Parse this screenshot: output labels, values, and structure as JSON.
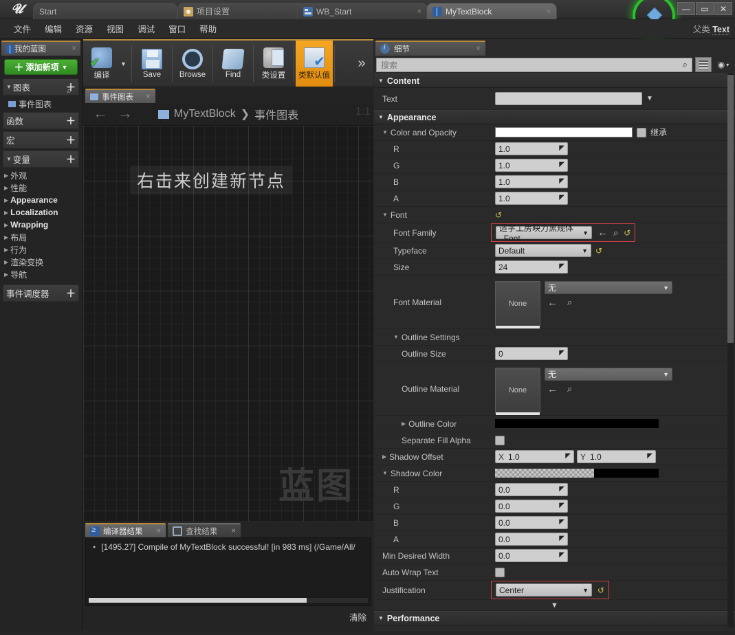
{
  "window": {
    "tabs": [
      {
        "label": "Start",
        "icon": "none",
        "active": false,
        "closable": false
      },
      {
        "label": "项目设置",
        "icon": "gear-icon",
        "active": false,
        "closable": true
      },
      {
        "label": "WB_Start",
        "icon": "widget-icon",
        "active": false,
        "closable": true
      },
      {
        "label": "MyTextBlock",
        "icon": "book-icon",
        "active": true,
        "closable": true
      }
    ],
    "minimize": "—",
    "maximize": "▭",
    "close": "✕"
  },
  "menu": {
    "items": [
      "文件",
      "编辑",
      "资源",
      "视图",
      "调试",
      "窗口",
      "帮助"
    ],
    "parent_class_label": "父类",
    "parent_class_value": "Text"
  },
  "left_panel": {
    "tab_label": "我的蓝图",
    "tab_close": "×",
    "add_button": "添加新项",
    "add_plus": "＋",
    "add_caret": "▼",
    "sections": [
      {
        "label": "图表",
        "plus": "＋",
        "expanded": true
      },
      {
        "label": "函数",
        "plus": "＋",
        "expanded": false
      },
      {
        "label": "宏",
        "plus": "＋",
        "expanded": false
      },
      {
        "label": "变量",
        "plus": "＋",
        "expanded": true
      }
    ],
    "graph_item": "事件图表",
    "variables": [
      {
        "label": "外观",
        "bold": false
      },
      {
        "label": "性能",
        "bold": false
      },
      {
        "label": "Appearance",
        "bold": true
      },
      {
        "label": "Localization",
        "bold": true
      },
      {
        "label": "Wrapping",
        "bold": true
      },
      {
        "label": "布局",
        "bold": false
      },
      {
        "label": "行为",
        "bold": false
      },
      {
        "label": "渲染变换",
        "bold": false
      },
      {
        "label": "导航",
        "bold": false
      }
    ],
    "dispatcher": {
      "label": "事件调度器",
      "plus": "＋"
    }
  },
  "toolbar": {
    "items": [
      {
        "label": "编译",
        "icon": "compile-icon",
        "active": false,
        "has_dropdown": true
      },
      {
        "label": "Save",
        "icon": "save-icon",
        "active": false
      },
      {
        "label": "Browse",
        "icon": "browse-icon",
        "active": false
      },
      {
        "label": "Find",
        "icon": "find-icon",
        "active": false
      },
      {
        "label": "类设置",
        "icon": "class-settings-icon",
        "active": false
      },
      {
        "label": "类默认值",
        "icon": "class-defaults-icon",
        "active": true
      }
    ],
    "overflow": "»"
  },
  "graph": {
    "tab_label": "事件图表",
    "tab_close": "×",
    "back_arrow": "←",
    "forward_arrow": "→",
    "breadcrumb_root": "MyTextBlock",
    "breadcrumb_sep": "❯",
    "breadcrumb_leaf": "事件图表",
    "zoom_level": "1:1",
    "hint": "右击来创建新节点",
    "watermark": "蓝图"
  },
  "results": {
    "tabs": [
      {
        "label": "编译器结果",
        "icon": "compiler-icon",
        "active": true,
        "close": "×"
      },
      {
        "label": "查找结果",
        "icon": "find-results-icon",
        "active": false,
        "close": "×"
      }
    ],
    "log_line": "[1495.27] Compile of MyTextBlock successful! [in 983 ms] (/Game/All/",
    "bullet": "•",
    "clear_button": "清除"
  },
  "details": {
    "tab_label": "细节",
    "tab_close": "×",
    "search_placeholder": "搜索",
    "search_icon": "magnifier-icon",
    "grid_button": "grid-view-icon",
    "eye_button": "visibility-icon",
    "eye_caret": "▾",
    "categories": [
      {
        "name": "Content",
        "expanded": true,
        "rows": [
          {
            "label": "Text",
            "type": "text-with-dropdown",
            "value": "",
            "caret": "▼"
          }
        ]
      },
      {
        "name": "Appearance",
        "expanded": true,
        "rows": [
          {
            "label": "Color and Opacity",
            "type": "color",
            "color": "#ffffff",
            "checkbox_label": "继承",
            "expandable": true
          },
          {
            "label": "R",
            "type": "number",
            "value": "1.0",
            "indent": 2
          },
          {
            "label": "G",
            "type": "number",
            "value": "1.0",
            "indent": 2
          },
          {
            "label": "B",
            "type": "number",
            "value": "1.0",
            "indent": 2
          },
          {
            "label": "A",
            "type": "number",
            "value": "1.0",
            "indent": 2
          }
        ]
      }
    ],
    "font_section": {
      "label": "Font",
      "reset_icon": "↺",
      "font_family_label": "Font Family",
      "font_family_value": "造字工房映力黑规体_Font",
      "font_family_caret": "▼",
      "font_family_back": "←",
      "font_family_search": "magnifier-icon",
      "font_family_reset": "↺",
      "typeface_label": "Typeface",
      "typeface_value": "Default",
      "typeface_caret": "▼",
      "typeface_reset": "↺",
      "size_label": "Size",
      "size_value": "24",
      "font_material_label": "Font Material",
      "font_material_thumb": "None",
      "font_material_value": "无",
      "font_material_caret": "▼"
    },
    "outline_section": {
      "label": "Outline Settings",
      "outline_size_label": "Outline Size",
      "outline_size_value": "0",
      "outline_material_label": "Outline Material",
      "outline_material_thumb": "None",
      "outline_material_value": "无",
      "outline_material_caret": "▼",
      "outline_color_label": "Outline Color",
      "outline_color_value": "#000000",
      "separate_fill_alpha_label": "Separate Fill Alpha",
      "separate_fill_alpha_checked": false
    },
    "shadow_section": {
      "shadow_offset_label": "Shadow Offset",
      "shadow_offset_x_axis": "X",
      "shadow_offset_x": "1.0",
      "shadow_offset_y_axis": "Y",
      "shadow_offset_y": "1.0",
      "shadow_color_label": "Shadow Color",
      "shadow_color_value": "#000000",
      "channels": [
        {
          "label": "R",
          "value": "0.0"
        },
        {
          "label": "G",
          "value": "0.0"
        },
        {
          "label": "B",
          "value": "0.0"
        },
        {
          "label": "A",
          "value": "0.0"
        }
      ]
    },
    "bottom_rows": {
      "min_desired_width_label": "Min Desired Width",
      "min_desired_width_value": "0.0",
      "auto_wrap_text_label": "Auto Wrap Text",
      "auto_wrap_text_checked": false,
      "justification_label": "Justification",
      "justification_value": "Center",
      "justification_caret": "▼",
      "justification_reset": "↺",
      "expand_chevron": "▼"
    },
    "performance_category": "Performance",
    "spin_glyph": "◤"
  },
  "colors": {
    "accent_orange": "#f5a623",
    "highlight_red": "#d2424a",
    "green_ring": "#27c427",
    "add_button_green": "#3f9f2c"
  }
}
